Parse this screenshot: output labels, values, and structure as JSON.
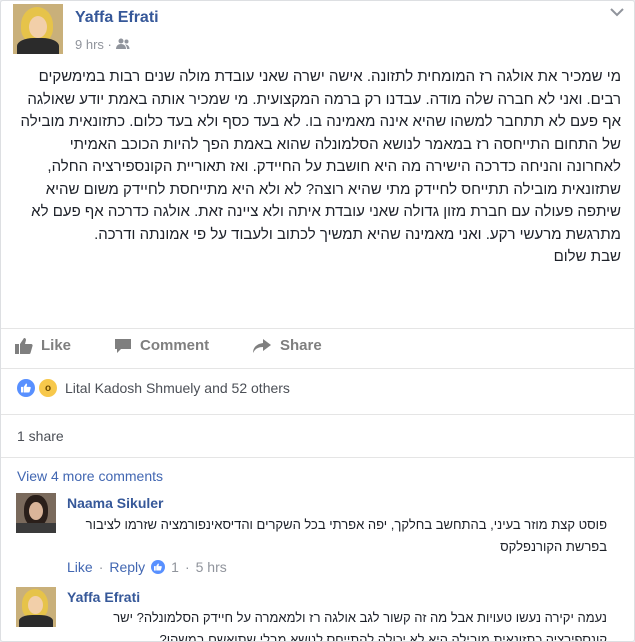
{
  "post": {
    "author": "Yaffa Efrati",
    "time": "9 hrs",
    "meta_separator": "·",
    "privacy_icon": "friends-icon",
    "menu_icon": "chevron-down-icon",
    "body": "מי שמכיר את אולגה רז המומחית לתזונה. אישה ישרה שאני עובדת מולה שנים רבות במימשקים רבים. ואני לא חברה שלה מודה. עבדנו רק ברמה המקצועית. מי שמכיר אותה באמת יודע שאולגה אף פעם לא תתחבר למשהו שהיא אינה מאמינה בו. לא בעד כסף ולא בעד כלום. כתזונאית מובילה של התחום התייחסה רז במאמר לנושא הסלמונלה שהוא באמת הפך להיות הכוכב האמיתי לאחרונה והניחה כדרכה הישירה מה היא חושבת על החיידק. ואז תאוריית הקונספירציה החלה, שתזונאית מובילה תתייחס לחיידק מתי שהיא רוצה? לא ולא היא מתייחסת לחיידק משום שהיא שיתפה פעולה עם חברת מזון גדולה שאני עובדת איתה ולא ציינה זאת. אולגה כדרכה אף פעם לא מתרגשת מרעשי רקע. ואני מאמינה שהיא תמשיך לכתוב ולעבוד על פי אמונתה ודרכה.\nשבת שלום"
  },
  "actions": {
    "like": "Like",
    "comment": "Comment",
    "share": "Share"
  },
  "reactions": {
    "icons": [
      "like-icon",
      "wow-icon"
    ],
    "text": "Lital Kadosh Shmuely and 52 others"
  },
  "shares": "1 share",
  "view_more": "View 4 more comments",
  "comments": [
    {
      "author": "Naama Sikuler",
      "text": "פוסט קצת מוזר בעיני, בהתחשב בחלקך, יפה אפרתי בכל השקרים והדיסאינפורמציה שזרמו לציבור בפרשת הקורנפלקס",
      "like": "Like",
      "reply": "Reply",
      "dot": "·",
      "likes": "1",
      "time": "5 hrs"
    },
    {
      "author": "Yaffa Efrati",
      "text": "נעמה יקירה נעשו טעויות אבל מה זה קשור לגב אולגה רז ולמאמרה על חיידק הסלמונלה? ישר קונספירציה כתזונאית מובילה היא לא יכולה להתייחס לנושא מבלי שתואשם במשהו?"
    }
  ]
}
